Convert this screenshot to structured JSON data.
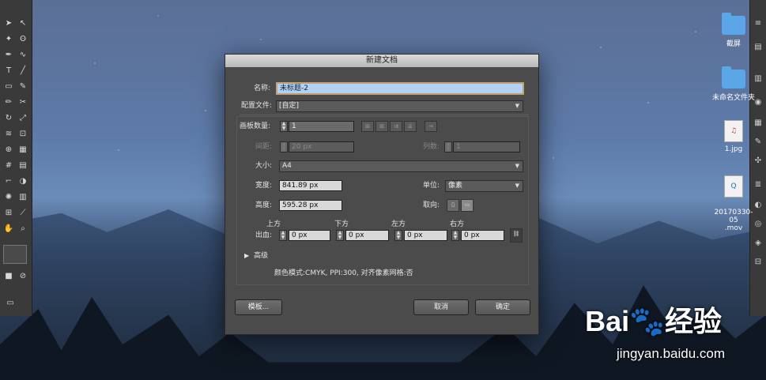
{
  "dialog": {
    "title": "新建文档",
    "name_label": "名称:",
    "name_value": "未标题-2",
    "profile_label": "配置文件:",
    "profile_value": "[自定]",
    "artboards_label": "画板数量:",
    "artboards_value": "1",
    "spacing_label": "间距:",
    "spacing_value": "20 px",
    "columns_label": "列数:",
    "columns_value": "1",
    "size_label": "大小:",
    "size_value": "A4",
    "width_label": "宽度:",
    "width_value": "841.89 px",
    "units_label": "单位:",
    "units_value": "像素",
    "height_label": "高度:",
    "height_value": "595.28 px",
    "orientation_label": "取向:",
    "bleed_label": "出血:",
    "bleed_top_label": "上方",
    "bleed_top_value": "0 px",
    "bleed_bottom_label": "下方",
    "bleed_bottom_value": "0 px",
    "bleed_left_label": "左方",
    "bleed_left_value": "0 px",
    "bleed_right_label": "右方",
    "bleed_right_value": "0 px",
    "advanced_label": "高级",
    "info_text": "颜色模式:CMYK, PPI:300, 对齐像素网格:否",
    "templates_button": "模板...",
    "cancel_button": "取消",
    "ok_button": "确定"
  },
  "desktop": {
    "icons": [
      {
        "label": "截屏",
        "type": "folder-icon"
      },
      {
        "label": "未命名文件夹",
        "type": "folder-icon"
      },
      {
        "label": "1.jpg",
        "type": "image-file-icon"
      },
      {
        "label": "20170330-05\n.mov",
        "type": "video-file-icon"
      }
    ]
  },
  "watermark": {
    "brand": "Bai",
    "brand_cn": "经验",
    "url": "jingyan.baidu.com"
  },
  "colors": {
    "dialog_bg": "#4b4b4b",
    "field_bg": "#d9d9d9",
    "selection": "#b3d1f5",
    "folder": "#5aa6e6"
  }
}
